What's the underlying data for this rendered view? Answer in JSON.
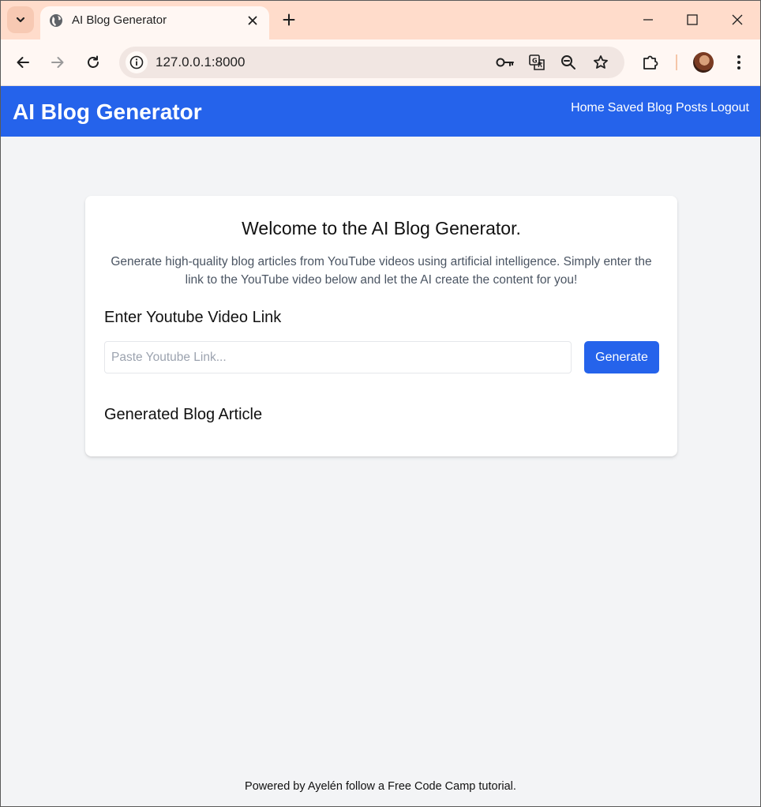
{
  "browser": {
    "tab_title": "AI Blog Generator",
    "url": "127.0.0.1:8000",
    "icons": {
      "tab_search": "chevron-down-icon",
      "favicon": "globe-icon",
      "tab_close": "close-icon",
      "new_tab": "plus-icon",
      "minimize": "minimize-icon",
      "maximize": "maximize-icon",
      "close_window": "close-icon",
      "back": "back-arrow-icon",
      "forward": "forward-arrow-icon",
      "reload": "reload-icon",
      "site_info": "info-icon",
      "passwords": "key-icon",
      "translate": "translate-icon",
      "zoom": "zoom-out-icon",
      "bookmark": "star-icon",
      "extensions": "puzzle-icon",
      "profile": "avatar",
      "menu": "kebab-menu-icon"
    },
    "colors": {
      "tabstrip": "#ffdccb",
      "toolbar": "#fff7f3"
    }
  },
  "header": {
    "title": "AI Blog Generator",
    "nav": [
      "Home",
      "Saved Blog Posts",
      "Logout"
    ]
  },
  "main": {
    "heading": "Welcome to the AI Blog Generator.",
    "description": "Generate high-quality blog articles from YouTube videos using artificial intelligence. Simply enter the link to the YouTube video below and let the AI create the content for you!",
    "link_label": "Enter Youtube Video Link",
    "input_placeholder": "Paste Youtube Link...",
    "input_value": "",
    "generate_label": "Generate",
    "article_label": "Generated Blog Article"
  },
  "footer": {
    "text": "Powered by Ayelén follow a Free Code Camp tutorial."
  },
  "colors": {
    "accent": "#2563eb",
    "background": "#f3f4f6"
  }
}
